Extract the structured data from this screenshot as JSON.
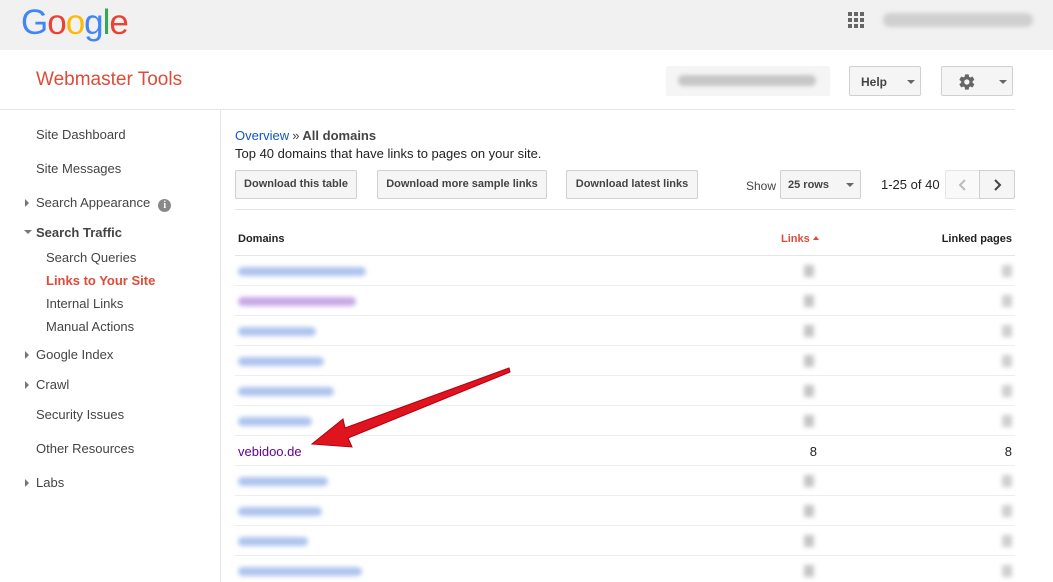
{
  "topbar": {
    "logo": [
      "G",
      "o",
      "o",
      "g",
      "l",
      "e"
    ],
    "logo_colors": [
      "#4285f4",
      "#ea4335",
      "#fbbc05",
      "#4285f4",
      "#34a853",
      "#ea4335"
    ]
  },
  "header": {
    "product_title": "Webmaster Tools",
    "help_label": "Help"
  },
  "sidebar": {
    "site_dashboard": "Site Dashboard",
    "site_messages": "Site Messages",
    "search_appearance": "Search Appearance",
    "info_glyph": "i",
    "search_traffic": "Search Traffic",
    "search_queries": "Search Queries",
    "links_to_your_site": "Links to Your Site",
    "internal_links": "Internal Links",
    "manual_actions": "Manual Actions",
    "google_index": "Google Index",
    "crawl": "Crawl",
    "security_issues": "Security Issues",
    "other_resources": "Other Resources",
    "labs": "Labs"
  },
  "content": {
    "breadcrumb_link": "Overview",
    "breadcrumb_sep": "»",
    "breadcrumb_current": "All domains",
    "description": "Top 40 domains that have links to pages on your site.",
    "download_table": "Download this table",
    "download_sample": "Download more sample links",
    "download_latest": "Download latest links",
    "show_label": "Show",
    "rows_value": "25 rows",
    "page_range": "1-25 of 40"
  },
  "table": {
    "col_domains": "Domains",
    "col_links": "Links",
    "col_linked_pages": "Linked pages",
    "visible_row": {
      "domain": "vebidoo.de",
      "links": "8",
      "linked_pages": "8"
    }
  },
  "colors": {
    "accent_red": "#dd4b39",
    "link_blue": "#1155cc",
    "visited_purple": "#660099",
    "annotation_red": "#e0141e"
  },
  "icons": {
    "apps": "apps-grid-icon",
    "settings": "gear-icon",
    "pager_prev": "chevron-left-icon",
    "pager_next": "chevron-right-icon",
    "sort": "sort-ascending-icon",
    "annotation": "red-arrow-annotation"
  }
}
